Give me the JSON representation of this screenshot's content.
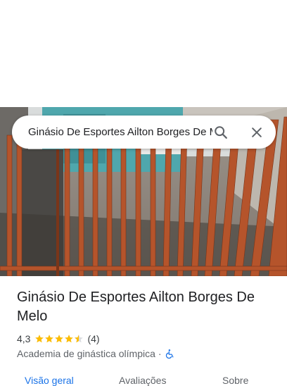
{
  "search": {
    "value": "Ginásio De Esportes Ailton Borges De Melo",
    "search_icon": "search-icon",
    "close_icon": "close-icon"
  },
  "place": {
    "name": "Ginásio De Esportes Ailton Borges De Melo",
    "rating": "4,3",
    "rating_value": 4.3,
    "rating_max": 5,
    "review_count": "(4)",
    "category": "Academia de ginástica olímpica",
    "separator": "·",
    "accessibility_icon": "wheelchair-icon"
  },
  "tabs": [
    {
      "label": "Visão geral",
      "active": true
    },
    {
      "label": "Avaliações",
      "active": false
    },
    {
      "label": "Sobre",
      "active": false
    }
  ],
  "colors": {
    "star": "#fbbc04",
    "accent": "#1a73e8",
    "fence": "#b5542b"
  }
}
